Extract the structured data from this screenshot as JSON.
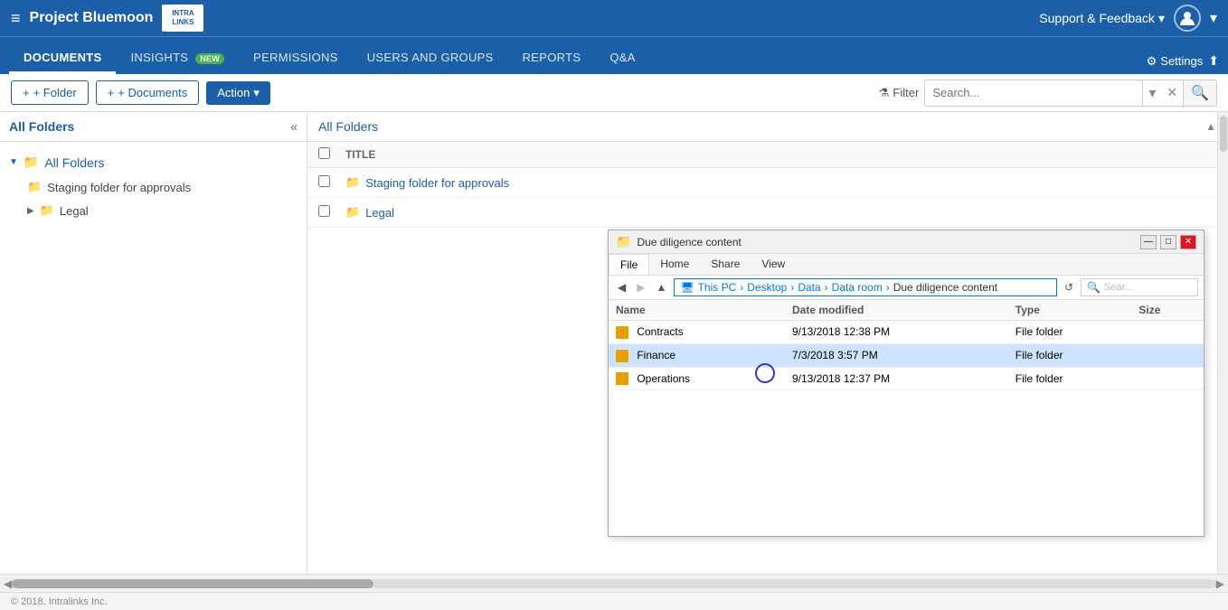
{
  "app": {
    "title": "Project Bluemoon",
    "logo_text": "INTRA\nLINKS"
  },
  "top_nav": {
    "support_label": "Support & Feedback",
    "hamburger_icon": "≡",
    "chevron_down": "▾",
    "user_icon": "👤"
  },
  "sub_nav": {
    "tabs": [
      {
        "label": "DOCUMENTS",
        "active": true,
        "badge": null
      },
      {
        "label": "INSIGHTS",
        "active": false,
        "badge": "new"
      },
      {
        "label": "PERMISSIONS",
        "active": false,
        "badge": null
      },
      {
        "label": "USERS AND GROUPS",
        "active": false,
        "badge": null
      },
      {
        "label": "REPORTS",
        "active": false,
        "badge": null
      },
      {
        "label": "Q&A",
        "active": false,
        "badge": null
      }
    ],
    "settings_label": "Settings"
  },
  "toolbar": {
    "folder_btn": "+ Folder",
    "documents_btn": "+ Documents",
    "action_btn": "Action",
    "filter_label": "Filter",
    "search_placeholder": "Search..."
  },
  "sidebar": {
    "title": "All Folders",
    "collapse_icon": "«",
    "tree": [
      {
        "label": "All Folders",
        "type": "root",
        "expanded": true
      },
      {
        "label": "Staging folder for approvals",
        "type": "child",
        "indent": 1
      },
      {
        "label": "Legal",
        "type": "child",
        "indent": 1
      }
    ]
  },
  "doc_list": {
    "breadcrumb": "All Folders",
    "column_title": "TITLE",
    "rows": [
      {
        "label": "Staging folder for approvals",
        "type": "folder"
      },
      {
        "label": "Legal",
        "type": "folder"
      }
    ]
  },
  "explorer": {
    "title": "Due diligence content",
    "address": {
      "path": [
        "This PC",
        "Desktop",
        "Data",
        "Data room",
        "Due diligence content"
      ]
    },
    "search_placeholder": "Sear...",
    "ribbon_tabs": [
      "File",
      "Home",
      "Share",
      "View"
    ],
    "active_ribbon_tab": "File",
    "columns": [
      "Name",
      "Date modified",
      "Type",
      "Size"
    ],
    "files": [
      {
        "name": "Contracts",
        "date": "9/13/2018 12:38 PM",
        "type": "File folder",
        "size": "",
        "selected": false
      },
      {
        "name": "Finance",
        "date": "7/3/2018 3:57 PM",
        "type": "File folder",
        "size": "",
        "selected": true
      },
      {
        "name": "Operations",
        "date": "9/13/2018 12:37 PM",
        "type": "File folder",
        "size": "",
        "selected": false
      }
    ]
  },
  "footer": {
    "copyright": "© 2018, Intralinks Inc."
  }
}
